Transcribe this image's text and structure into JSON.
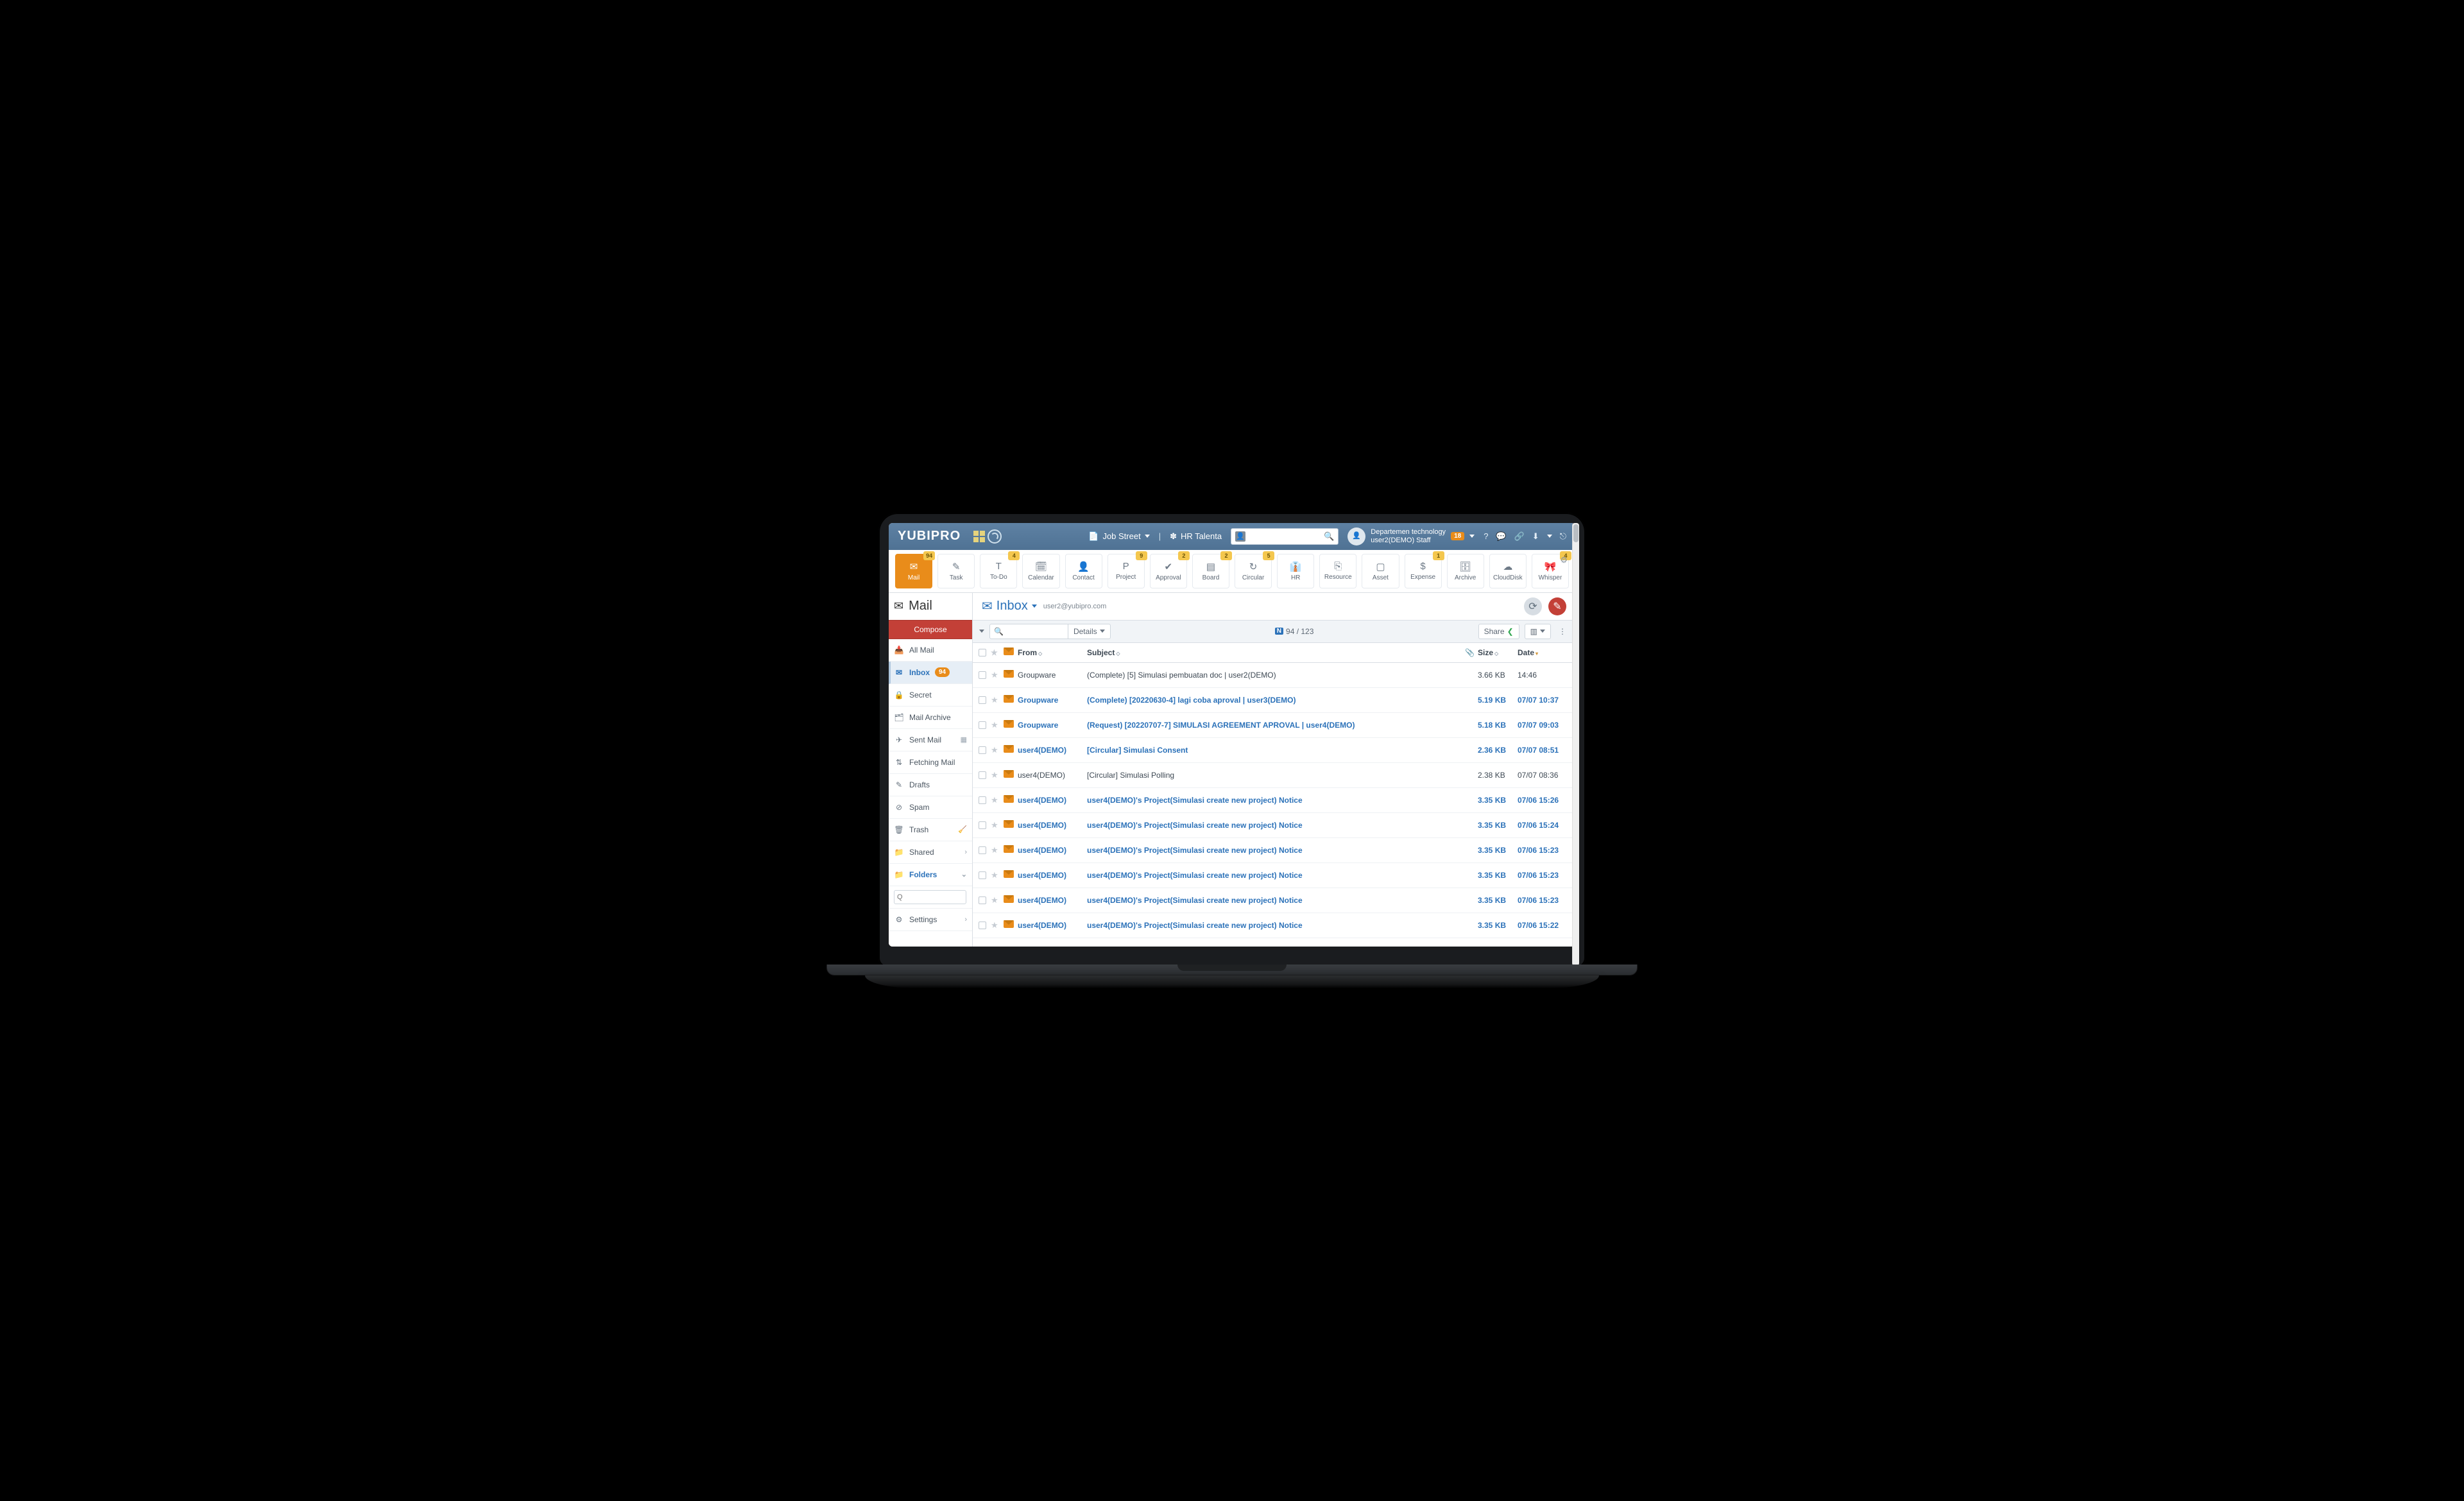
{
  "brand": "YUBIPRO",
  "header": {
    "nav1": "Job Street",
    "nav2": "HR Talenta",
    "user_dept": "Departemen technology",
    "user_name": "user2(DEMO) Staff",
    "notif_badge": "18"
  },
  "apptabs": [
    {
      "label": "Mail",
      "badge": "94",
      "icon": "✉",
      "active": true
    },
    {
      "label": "Task",
      "icon": "✎"
    },
    {
      "label": "To-Do",
      "badge": "4",
      "icon": "T"
    },
    {
      "label": "Calendar",
      "icon": "🗓"
    },
    {
      "label": "Contact",
      "icon": "👤"
    },
    {
      "label": "Project",
      "badge": "9",
      "icon": "P"
    },
    {
      "label": "Approval",
      "badge": "2",
      "icon": "✔"
    },
    {
      "label": "Board",
      "badge": "2",
      "icon": "▤"
    },
    {
      "label": "Circular",
      "badge": "5",
      "icon": "↻"
    },
    {
      "label": "HR",
      "icon": "👔"
    },
    {
      "label": "Resource",
      "icon": "⎘"
    },
    {
      "label": "Asset",
      "icon": "▢"
    },
    {
      "label": "Expense",
      "badge": "1",
      "icon": "$"
    },
    {
      "label": "Archive",
      "icon": "🗄"
    },
    {
      "label": "CloudDisk",
      "icon": "☁"
    },
    {
      "label": "Whisper",
      "badge": "4",
      "icon": "🎀"
    }
  ],
  "sidebar": {
    "title": "Mail",
    "compose": "Compose",
    "items": [
      {
        "icon": "📥",
        "label": "All Mail"
      },
      {
        "icon": "✉",
        "label": "Inbox",
        "pill": "94",
        "active": true
      },
      {
        "icon": "🔒",
        "label": "Secret"
      },
      {
        "icon": "🗂",
        "label": "Mail Archive"
      },
      {
        "icon": "✈",
        "label": "Sent Mail",
        "right": "▦"
      },
      {
        "icon": "⇅",
        "label": "Fetching Mail"
      },
      {
        "icon": "✎",
        "label": "Drafts"
      },
      {
        "icon": "⊘",
        "label": "Spam"
      },
      {
        "icon": "🗑",
        "label": "Trash",
        "right": "🧹"
      },
      {
        "icon": "📁",
        "label": "Shared",
        "right": "›"
      },
      {
        "icon": "📁",
        "label": "Folders",
        "right": "⌄",
        "accent": true
      },
      {
        "type": "search",
        "placeholder": "Q"
      },
      {
        "icon": "⚙",
        "label": "Settings",
        "right": "›"
      }
    ]
  },
  "content": {
    "title": "Inbox",
    "address": "user2@yubipro.com",
    "toolbar": {
      "details": "Details",
      "count": "94 / 123",
      "share": "Share"
    },
    "cols": {
      "from": "From",
      "subject": "Subject",
      "size": "Size",
      "date": "Date"
    },
    "rows": [
      {
        "from": "Groupware",
        "subject": "(Complete) [5] Simulasi pembuatan doc | user2(DEMO)",
        "size": "3.66 KB",
        "date": "14:46",
        "unread": false
      },
      {
        "from": "Groupware",
        "subject": "(Complete) [20220630-4] lagi coba aproval | user3(DEMO)",
        "size": "5.19 KB",
        "date": "07/07 10:37",
        "unread": true
      },
      {
        "from": "Groupware",
        "subject": "(Request) [20220707-7] SIMULASI AGREEMENT APROVAL | user4(DEMO)",
        "size": "5.18 KB",
        "date": "07/07 09:03",
        "unread": true
      },
      {
        "from": "user4(DEMO)",
        "subject": "[Circular] Simulasi Consent",
        "size": "2.36 KB",
        "date": "07/07 08:51",
        "unread": true
      },
      {
        "from": "user4(DEMO)",
        "subject": "[Circular] Simulasi Polling",
        "size": "2.38 KB",
        "date": "07/07 08:36",
        "unread": false
      },
      {
        "from": "user4(DEMO)",
        "subject": "user4(DEMO)'s Project(Simulasi create new project) Notice",
        "size": "3.35 KB",
        "date": "07/06 15:26",
        "unread": true
      },
      {
        "from": "user4(DEMO)",
        "subject": "user4(DEMO)'s Project(Simulasi create new project) Notice",
        "size": "3.35 KB",
        "date": "07/06 15:24",
        "unread": true
      },
      {
        "from": "user4(DEMO)",
        "subject": "user4(DEMO)'s Project(Simulasi create new project) Notice",
        "size": "3.35 KB",
        "date": "07/06 15:23",
        "unread": true
      },
      {
        "from": "user4(DEMO)",
        "subject": "user4(DEMO)'s Project(Simulasi create new project) Notice",
        "size": "3.35 KB",
        "date": "07/06 15:23",
        "unread": true
      },
      {
        "from": "user4(DEMO)",
        "subject": "user4(DEMO)'s Project(Simulasi create new project) Notice",
        "size": "3.35 KB",
        "date": "07/06 15:23",
        "unread": true
      },
      {
        "from": "user4(DEMO)",
        "subject": "user4(DEMO)'s Project(Simulasi create new project) Notice",
        "size": "3.35 KB",
        "date": "07/06 15:22",
        "unread": true
      }
    ]
  }
}
